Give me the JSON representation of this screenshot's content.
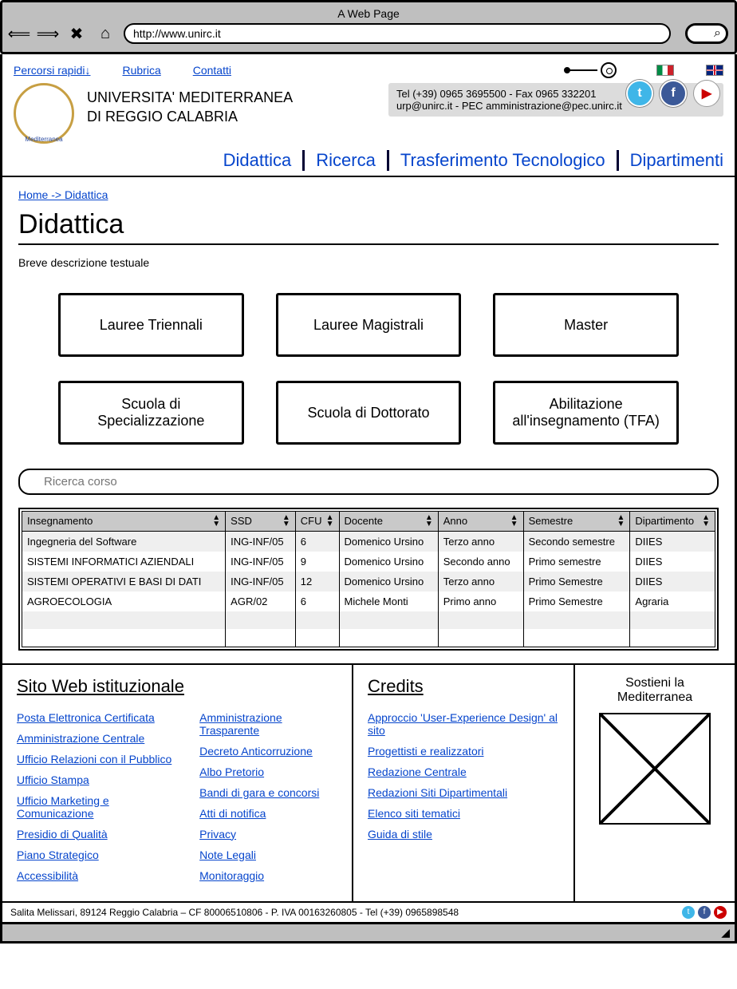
{
  "chrome": {
    "title": "A Web Page",
    "url": "http://www.unirc.it"
  },
  "top_links": {
    "quick": "Percorsi rapidi↓",
    "rubrica": "Rubrica",
    "contatti": "Contatti"
  },
  "university": {
    "line1": "UNIVERSITA' MEDITERRANEA",
    "line2": "DI REGGIO CALABRIA"
  },
  "contact": {
    "line1": "Tel (+39) 0965 3695500 - Fax 0965 332201",
    "line2": "urp@unirc.it   - PEC amministrazione@pec.unirc.it"
  },
  "nav": {
    "didattica": "Didattica",
    "ricerca": "Ricerca",
    "trasferimento": "Trasferimento Tecnologico",
    "dipartimenti": "Dipartimenti"
  },
  "breadcrumb": "Home -> Didattica",
  "page_title": "Didattica",
  "page_desc": "Breve descrizione  testuale",
  "categories": {
    "c1": "Lauree Triennali",
    "c2": "Lauree Magistrali",
    "c3": "Master",
    "c4": "Scuola di Specializzazione",
    "c5": "Scuola di Dottorato",
    "c6": "Abilitazione all'insegnamento (TFA)"
  },
  "search_placeholder": "Ricerca corso",
  "table": {
    "headers": {
      "h1": "Insegnamento",
      "h2": "SSD",
      "h3": "CFU",
      "h4": "Docente",
      "h5": "Anno",
      "h6": "Semestre",
      "h7": "Dipartimento"
    },
    "rows": [
      {
        "c1": "Ingegneria del Software",
        "c2": "ING-INF/05",
        "c3": "6",
        "c4": "Domenico Ursino",
        "c5": "Terzo anno",
        "c6": "Secondo semestre",
        "c7": "DIIES"
      },
      {
        "c1": "SISTEMI INFORMATICI AZIENDALI",
        "c2": "ING-INF/05",
        "c3": "9",
        "c4": "Domenico Ursino",
        "c5": "Secondo anno",
        "c6": "Primo semestre",
        "c7": "DIIES"
      },
      {
        "c1": "SISTEMI OPERATIVI E BASI DI DATI",
        "c2": "ING-INF/05",
        "c3": "12",
        "c4": "Domenico Ursino",
        "c5": "Terzo anno",
        "c6": "Primo Semestre",
        "c7": "DIIES"
      },
      {
        "c1": "AGROECOLOGIA",
        "c2": "AGR/02",
        "c3": "6",
        "c4": "Michele Monti",
        "c5": "Primo anno",
        "c6": "Primo Semestre",
        "c7": "Agraria"
      }
    ]
  },
  "footer": {
    "col1_title": "Sito Web istituzionale",
    "col1_a": [
      "Posta Elettronica Certificata",
      "Amministrazione Centrale",
      "Ufficio Relazioni con il Pubblico",
      "Ufficio Stampa",
      "Ufficio Marketing e Comunicazione",
      "Presidio di Qualità",
      "Piano Strategico",
      "Accessibilità"
    ],
    "col1_b": [
      "Amministrazione Trasparente",
      "Decreto Anticorruzione",
      "Albo Pretorio",
      "Bandi di gara e concorsi",
      "Atti di notifica",
      "Privacy",
      "Note Legali",
      "Monitoraggio"
    ],
    "col2_title": "Credits",
    "col2": [
      "Approccio 'User-Experience Design' al sito",
      "Progettisti e realizzatori",
      "Redazione Centrale",
      "Redazioni Siti Dipartimentali",
      "Elenco siti tematici",
      "Guida di stile"
    ],
    "col3_line1": "Sostieni la",
    "col3_line2": "Mediterranea"
  },
  "bottom": "Salita Melissari, 89124 Reggio Calabria – CF 80006510806 - P. IVA 00163260805 - Tel (+39) 0965898548"
}
